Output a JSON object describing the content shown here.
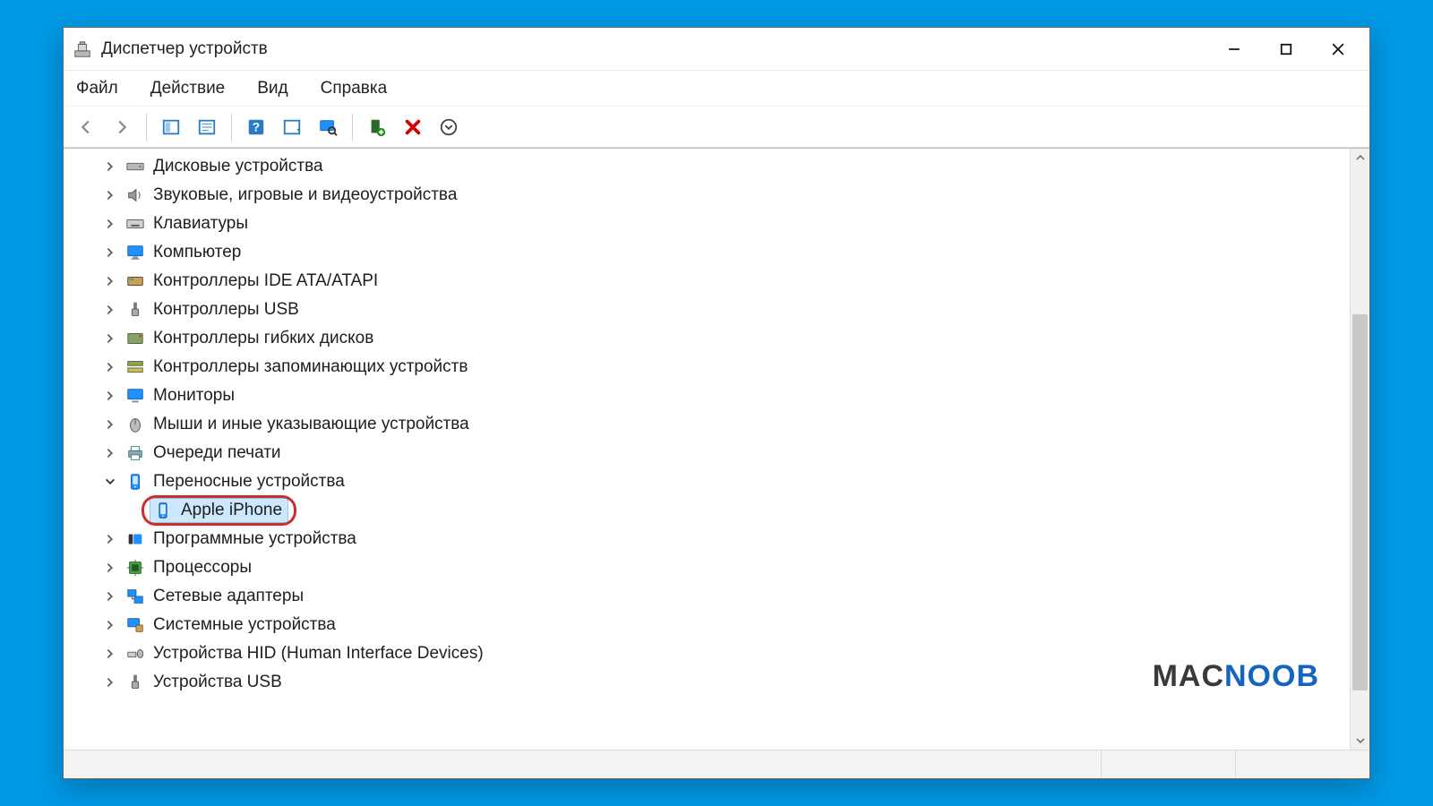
{
  "window": {
    "title": "Диспетчер устройств"
  },
  "menubar": {
    "items": [
      {
        "label": "Файл"
      },
      {
        "label": "Действие"
      },
      {
        "label": "Вид"
      },
      {
        "label": "Справка"
      }
    ]
  },
  "toolbar": {
    "back_icon": "arrow-left",
    "forward_icon": "arrow-right",
    "show_hidden_icon": "panel",
    "properties_icon": "properties",
    "help_icon": "help",
    "scan_icon": "scan",
    "update_icon": "monitor-search",
    "add_hw_icon": "chip-add",
    "delete_icon": "delete-x",
    "more_icon": "circle-down"
  },
  "tree": {
    "items": [
      {
        "label": "Дисковые устройства",
        "icon": "hdd",
        "expanded": false
      },
      {
        "label": "Звуковые, игровые и видеоустройства",
        "icon": "speaker",
        "expanded": false
      },
      {
        "label": "Клавиатуры",
        "icon": "keyboard",
        "expanded": false
      },
      {
        "label": "Компьютер",
        "icon": "computer",
        "expanded": false
      },
      {
        "label": "Контроллеры IDE ATA/ATAPI",
        "icon": "ide",
        "expanded": false
      },
      {
        "label": "Контроллеры USB",
        "icon": "usb",
        "expanded": false
      },
      {
        "label": "Контроллеры гибких дисков",
        "icon": "floppyctrl",
        "expanded": false
      },
      {
        "label": "Контроллеры запоминающих устройств",
        "icon": "storagectrl",
        "expanded": false
      },
      {
        "label": "Мониторы",
        "icon": "monitor",
        "expanded": false
      },
      {
        "label": "Мыши и иные указывающие устройства",
        "icon": "mouse",
        "expanded": false
      },
      {
        "label": "Очереди печати",
        "icon": "printer",
        "expanded": false
      },
      {
        "label": "Переносные устройства",
        "icon": "portable",
        "expanded": true,
        "children": [
          {
            "label": "Apple iPhone",
            "icon": "phone",
            "selected": true,
            "annotated": true
          }
        ]
      },
      {
        "label": "Программные устройства",
        "icon": "softdev",
        "expanded": false
      },
      {
        "label": "Процессоры",
        "icon": "cpu",
        "expanded": false
      },
      {
        "label": "Сетевые адаптеры",
        "icon": "netadapter",
        "expanded": false
      },
      {
        "label": "Системные устройства",
        "icon": "sysdev",
        "expanded": false
      },
      {
        "label": "Устройства HID (Human Interface Devices)",
        "icon": "hid",
        "expanded": false
      },
      {
        "label": "Устройства USB",
        "icon": "usb",
        "expanded": false
      }
    ]
  },
  "watermark": {
    "part1": "MAC",
    "part2": "NOOB"
  },
  "colors": {
    "accent": "#0078d4",
    "selection": "#cce8ff",
    "annotation": "#d22b2b"
  }
}
